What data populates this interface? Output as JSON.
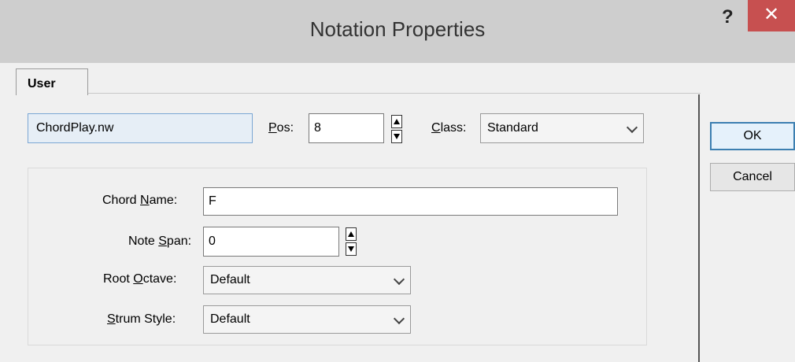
{
  "window": {
    "title": "Notation Properties",
    "help_label": "?",
    "close_label": "✕"
  },
  "tabs": [
    {
      "label": "User"
    }
  ],
  "file_field": {
    "value": "ChordPlay.nw"
  },
  "pos": {
    "label_pre": "",
    "label_accel": "P",
    "label_post": "os:",
    "value": "8"
  },
  "class": {
    "label_accel": "C",
    "label_post": "lass:",
    "value": "Standard"
  },
  "chord_name": {
    "label_pre": "Chord ",
    "label_accel": "N",
    "label_post": "ame:",
    "value": "F"
  },
  "note_span": {
    "label_pre": "Note ",
    "label_accel": "S",
    "label_post": "pan:",
    "value": "0"
  },
  "root_octave": {
    "label_pre": "Root ",
    "label_accel": "O",
    "label_post": "ctave:",
    "value": "Default"
  },
  "strum_style": {
    "label_pre": "",
    "label_accel": "S",
    "label_post": "trum Style:",
    "value": "Default"
  },
  "buttons": {
    "ok": "OK",
    "cancel": "Cancel"
  }
}
